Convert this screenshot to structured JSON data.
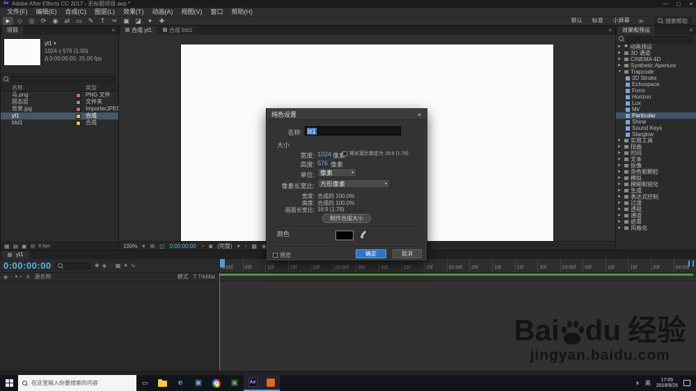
{
  "colors": {
    "accent_blue": "#2d74c4",
    "selection": "#41546a",
    "canvas_white": "#fbfbfb",
    "work_area_green": "#4a9a3f",
    "timecode_blue": "#5ab3e8",
    "baidu_logo": "#141414",
    "ae_icon_purple": "#a18ff0"
  },
  "icons": {
    "panel_menu": "≡",
    "dropdown_arrow": "▾",
    "expand_arrow": "▶",
    "collapse_arrow": "▼"
  },
  "window": {
    "app_badge": "Ae",
    "title": "Adobe After Effects CC 2017 - 无标题项目.aep *",
    "minimize": "—",
    "maximize": "▢",
    "close": "✕"
  },
  "menu": {
    "items": [
      "文件(F)",
      "编辑(E)",
      "合成(C)",
      "图层(L)",
      "效果(T)",
      "动画(A)",
      "视图(V)",
      "窗口",
      "帮助(H)"
    ]
  },
  "toolbar": {
    "tools": [
      {
        "name": "selection-tool-icon",
        "glyph": "►"
      },
      {
        "name": "hand-tool-icon",
        "glyph": "◇"
      },
      {
        "name": "zoom-tool-icon",
        "glyph": "◎"
      },
      {
        "name": "rotation-tool-icon",
        "glyph": "⟳"
      },
      {
        "name": "camera-tool-icon",
        "glyph": "◉"
      },
      {
        "name": "pan-behind-tool-icon",
        "glyph": "⇄"
      },
      {
        "name": "shape-tool-icon",
        "glyph": "▭"
      },
      {
        "name": "pen-tool-icon",
        "glyph": "✎"
      },
      {
        "name": "type-tool-icon",
        "glyph": "T"
      },
      {
        "name": "brush-tool-icon",
        "glyph": "✑"
      },
      {
        "name": "clone-stamp-tool-icon",
        "glyph": "▣"
      },
      {
        "name": "eraser-tool-icon",
        "glyph": "◪"
      },
      {
        "name": "roto-brush-tool-icon",
        "glyph": "✦"
      },
      {
        "name": "puppet-pin-tool-icon",
        "glyph": "✚"
      }
    ],
    "workspaces": [
      "默认",
      "标准",
      "小屏幕"
    ],
    "overflow": "≫",
    "help_search": "搜索帮助"
  },
  "project": {
    "tab": "项目",
    "preview": {
      "comp_name": "yt1",
      "dims": "1024 x 576 (1.00)",
      "timing": "Δ 0:00:05:00, 25.00 fps"
    },
    "columns": {
      "name": "名称",
      "type": "类型"
    },
    "items": [
      {
        "name": "马.png",
        "type": "PNG 文件",
        "label_color": "#d05c9a",
        "selected": false
      },
      {
        "name": "固态层",
        "type": "文件夹",
        "label_color": "#8a8a8a",
        "selected": false
      },
      {
        "name": "背景.jpg",
        "type": "ImporterJPEG",
        "label_color": "#d05c9a",
        "selected": false
      },
      {
        "name": "yt1",
        "type": "合成",
        "label_color": "#e0c04a",
        "selected": true
      },
      {
        "name": "btd1",
        "type": "合成",
        "label_color": "#e0c04a",
        "selected": false
      }
    ],
    "footer": {
      "bpc": "8 bpc",
      "icons": [
        {
          "name": "interpret-footage-icon",
          "glyph": "▦"
        },
        {
          "name": "new-folder-icon",
          "glyph": "▤"
        },
        {
          "name": "new-composition-icon",
          "glyph": "▣"
        },
        {
          "name": "delete-item-icon",
          "glyph": "⊟"
        }
      ]
    }
  },
  "viewer": {
    "tabs": [
      {
        "label": "合成 yt1",
        "active": true
      },
      {
        "label": "合成 btd1",
        "active": false
      }
    ],
    "statusbar": {
      "zoom": "100%",
      "timecode": "0:00:00:00",
      "resolution": "(完整)",
      "icons": [
        {
          "name": "zoom-menu-arrow-icon",
          "glyph": "▾"
        },
        {
          "name": "grid-guides-icon",
          "glyph": "⊞"
        },
        {
          "name": "mask-visibility-icon",
          "glyph": "◫"
        },
        {
          "name": "snapshot-icon",
          "glyph": "◔"
        },
        {
          "name": "show-channel-icon",
          "glyph": "◙"
        },
        {
          "name": "resolution-menu-arrow-icon",
          "glyph": "▾"
        },
        {
          "name": "region-of-interest-icon",
          "glyph": "▫"
        },
        {
          "name": "transparency-grid-icon",
          "glyph": "▩"
        },
        {
          "name": "camera-view-icon",
          "glyph": "◉"
        },
        {
          "name": "view-layout-icon",
          "glyph": "▣"
        }
      ]
    }
  },
  "effects": {
    "panel_title": "效果和预设",
    "tree": [
      {
        "label": "动画预设",
        "depth": 0,
        "type": "category",
        "expanded": false,
        "star": true
      },
      {
        "label": "3D 通道",
        "depth": 0,
        "type": "category",
        "expanded": false
      },
      {
        "label": "CINEMA 4D",
        "depth": 0,
        "type": "category",
        "expanded": false
      },
      {
        "label": "Synthetic Aperture",
        "depth": 0,
        "type": "category",
        "expanded": false
      },
      {
        "label": "Trapcode",
        "depth": 0,
        "type": "category",
        "expanded": true
      },
      {
        "label": "3D Stroke",
        "depth": 1,
        "type": "effect"
      },
      {
        "label": "Echospace",
        "depth": 1,
        "type": "effect"
      },
      {
        "label": "Form",
        "depth": 1,
        "type": "effect"
      },
      {
        "label": "Horizon",
        "depth": 1,
        "type": "effect"
      },
      {
        "label": "Lux",
        "depth": 1,
        "type": "effect"
      },
      {
        "label": "Mir",
        "depth": 1,
        "type": "effect"
      },
      {
        "label": "Particular",
        "depth": 1,
        "type": "effect",
        "selected": true
      },
      {
        "label": "Shine",
        "depth": 1,
        "type": "effect"
      },
      {
        "label": "Sound Keys",
        "depth": 1,
        "type": "effect"
      },
      {
        "label": "Starglow",
        "depth": 1,
        "type": "effect"
      },
      {
        "label": "实用工具",
        "depth": 0,
        "type": "category",
        "expanded": false
      },
      {
        "label": "扭曲",
        "depth": 0,
        "type": "category",
        "expanded": false
      },
      {
        "label": "时间",
        "depth": 0,
        "type": "category",
        "expanded": false
      },
      {
        "label": "文本",
        "depth": 0,
        "type": "category",
        "expanded": false
      },
      {
        "label": "抠像",
        "depth": 0,
        "type": "category",
        "expanded": false
      },
      {
        "label": "杂色和颗粒",
        "depth": 0,
        "type": "category",
        "expanded": false
      },
      {
        "label": "模拟",
        "depth": 0,
        "type": "category",
        "expanded": false
      },
      {
        "label": "模糊和锐化",
        "depth": 0,
        "type": "category",
        "expanded": false
      },
      {
        "label": "生成",
        "depth": 0,
        "type": "category",
        "expanded": false
      },
      {
        "label": "表达式控制",
        "depth": 0,
        "type": "category",
        "expanded": false
      },
      {
        "label": "过渡",
        "depth": 0,
        "type": "category",
        "expanded": false
      },
      {
        "label": "透视",
        "depth": 0,
        "type": "category",
        "expanded": false
      },
      {
        "label": "通道",
        "depth": 0,
        "type": "category",
        "expanded": false
      },
      {
        "label": "遮罩",
        "depth": 0,
        "type": "category",
        "expanded": false
      },
      {
        "label": "风格化",
        "depth": 0,
        "type": "category",
        "expanded": false
      }
    ]
  },
  "dialog": {
    "title": "纯色设置",
    "close": "✕",
    "name_label": "名称:",
    "name_value": "lz1",
    "size_label": "大小",
    "width_label": "宽度:",
    "width_value": "1024",
    "height_label": "高度:",
    "height_value": "576",
    "unit_suffix": "像素",
    "lock_label": "将长宽比锁定为 16:9 (1.78)",
    "units_label": "单位:",
    "units_value": "像素",
    "par_label": "像素长宽比:",
    "par_value": "方形像素",
    "comp_width_label": "宽度:",
    "comp_width_value": "合成的 100.0%",
    "comp_height_label": "高度:",
    "comp_height_value": "合成的 100.0%",
    "frame_aspect_label": "画面长宽比:",
    "frame_aspect_value": "16:9 (1.78)",
    "make_comp_button": "制作合成大小",
    "color_label": "颜色",
    "preview_label": "预览",
    "ok": "确定",
    "cancel": "取消"
  },
  "timeline": {
    "tab": "yt1",
    "timecode": "0:00:00:00",
    "toggles": [
      {
        "name": "composition-mini-flowchart-icon",
        "glyph": "❖"
      },
      {
        "name": "draft-3d-icon",
        "glyph": "◈"
      },
      {
        "name": "hide-shy-layers-icon",
        "glyph": "◌"
      },
      {
        "name": "frame-blending-icon",
        "glyph": "▦"
      },
      {
        "name": "motion-blur-icon",
        "glyph": "✦"
      },
      {
        "name": "graph-editor-icon",
        "glyph": "∿"
      }
    ],
    "left_icons": [
      {
        "name": "video-toggle-icon",
        "glyph": "◉"
      },
      {
        "name": "audio-toggle-icon",
        "glyph": "◌"
      },
      {
        "name": "solo-toggle-icon",
        "glyph": "●"
      },
      {
        "name": "lock-toggle-icon",
        "glyph": "▪"
      }
    ],
    "columns": {
      "hash": "#",
      "source": "源名称",
      "mode": "模式",
      "trkmat": "T TrkMat"
    },
    "ruler": [
      "0:00f",
      "05f",
      "10f",
      "15f",
      "20f",
      "01:00f",
      "05f",
      "10f",
      "15f",
      "20f",
      "02:00f",
      "05f",
      "10f",
      "15f",
      "20f",
      "03:00f",
      "05f",
      "10f",
      "15f",
      "20f",
      "04:00f"
    ]
  },
  "watermark": {
    "brand_left": "Bai",
    "brand_right": "du",
    "brand_cn": "经验",
    "url": "jingyan.baidu.com"
  },
  "taskbar": {
    "search_placeholder": "在这里输入你要搜索的内容",
    "taskview_glyph": "▭",
    "apps": [
      {
        "name": "file-explorer-icon",
        "kind": "folder",
        "active": false
      },
      {
        "name": "edge-browser-icon",
        "kind": "glyph",
        "glyph": "e",
        "color": "#45a7e8",
        "active": false
      },
      {
        "name": "store-app-icon",
        "kind": "glyph",
        "glyph": "▣",
        "color": "#6f9fd8",
        "active": false
      },
      {
        "name": "chrome-browser-icon",
        "kind": "chrome",
        "active": false
      },
      {
        "name": "wechat-app-icon",
        "kind": "glyph",
        "glyph": "▣",
        "color": "#57b357",
        "active": false
      },
      {
        "name": "after-effects-icon",
        "kind": "ae",
        "label": "Ae",
        "active": true
      },
      {
        "name": "browser-app-icon",
        "kind": "square",
        "color": "#e8622c",
        "active": true
      }
    ],
    "tray": {
      "chevron": "∧",
      "ime": "英",
      "time": "17:05",
      "date": "2019/9/25"
    }
  }
}
